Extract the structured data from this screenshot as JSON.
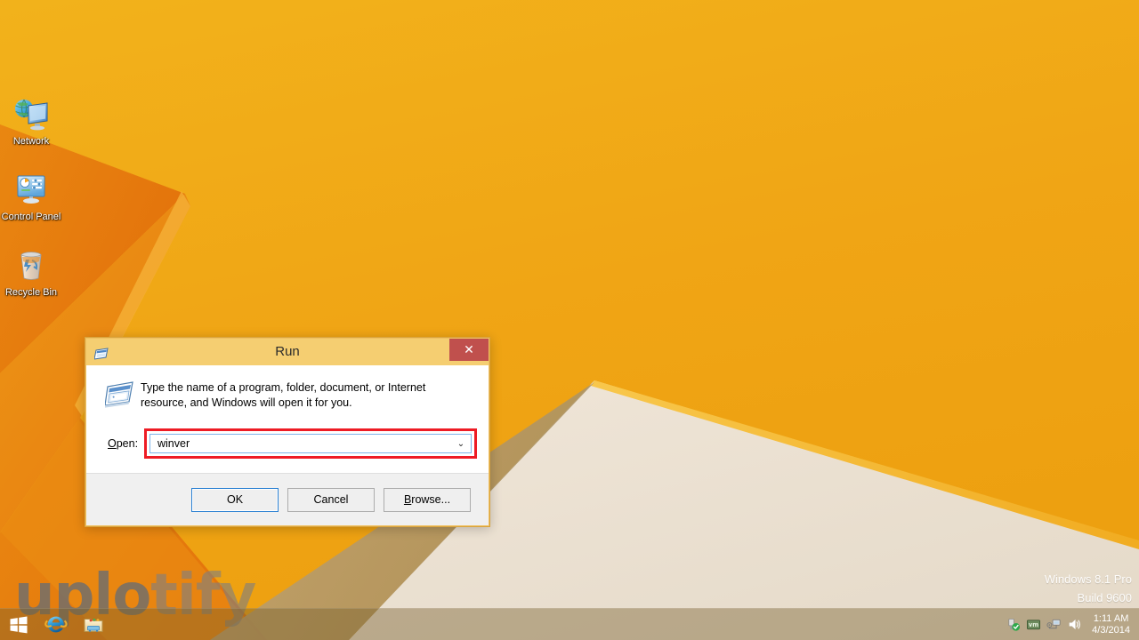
{
  "desktop": {
    "icons": [
      {
        "label": "Network",
        "icon": "network-icon"
      },
      {
        "label": "Control Panel",
        "icon": "control-panel-icon"
      },
      {
        "label": "Recycle Bin",
        "icon": "recycle-bin-icon"
      }
    ],
    "version_watermark": {
      "line1": "Windows 8.1 Pro",
      "line2": "Build 9600"
    },
    "brand_watermark": {
      "part1": "uplo",
      "part2": "tify"
    },
    "wallpaper_colors": {
      "yellow": "#F5AE17",
      "yellow_light": "#F7B71D",
      "orange_dark": "#E8760F",
      "orange_mid": "#F08C14",
      "cream": "#F1E6D7",
      "khaki": "#B59A6A"
    }
  },
  "taskbar": {
    "start_button": "Start",
    "start_icon": "windows-logo-icon",
    "pinned": [
      {
        "name": "Internet Explorer",
        "icon": "internet-explorer-icon"
      },
      {
        "name": "File Explorer",
        "icon": "file-explorer-icon"
      }
    ],
    "tray": [
      {
        "name": "Safely Remove Hardware",
        "icon": "usb-eject-icon"
      },
      {
        "name": "VMware Tools",
        "icon": "vmware-tools-icon"
      },
      {
        "name": "Network",
        "icon": "network-tray-icon"
      },
      {
        "name": "Volume",
        "icon": "speaker-icon"
      }
    ],
    "clock": {
      "time": "1:11 AM",
      "date": "4/3/2014"
    }
  },
  "run_dialog": {
    "title": "Run",
    "title_icon": "run-window-icon",
    "body_icon": "run-window-icon",
    "close_label": "✕",
    "description": "Type the name of a program, folder, document, or Internet resource, and Windows will open it for you.",
    "open_label_prefix": "O",
    "open_label_rest": "pen:",
    "open_value": "winver",
    "open_placeholder": "",
    "dropdown_arrow": "⌄",
    "highlight_color": "#EE1C25",
    "buttons": {
      "ok": "OK",
      "cancel": "Cancel",
      "browse_prefix": "B",
      "browse_rest": "rowse..."
    }
  }
}
